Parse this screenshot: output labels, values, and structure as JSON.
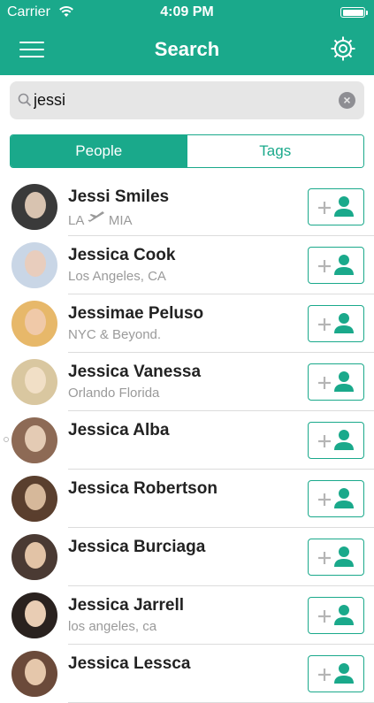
{
  "status_bar": {
    "carrier": "Carrier",
    "time": "4:09 PM"
  },
  "nav": {
    "title": "Search"
  },
  "search": {
    "value": "jessi",
    "clear_icon": "clear-icon"
  },
  "segments": [
    {
      "label": "People",
      "active": true
    },
    {
      "label": "Tags",
      "active": false
    }
  ],
  "colors": {
    "accent": "#1aa98b",
    "separator": "#dcdcdc",
    "subtitle": "#9a9a9a"
  },
  "people": [
    {
      "name": "Jessi Smiles",
      "subtitle_pre": "LA ",
      "subtitle_icon": "airplane-icon",
      "subtitle_post": " MIA"
    },
    {
      "name": "Jessica Cook",
      "subtitle": "Los Angeles, CA"
    },
    {
      "name": "Jessimae Peluso",
      "subtitle": "NYC & Beyond."
    },
    {
      "name": "Jessica Vanessa",
      "subtitle": "Orlando Florida"
    },
    {
      "name": "Jessica Alba",
      "subtitle": ""
    },
    {
      "name": "Jessica Robertson",
      "subtitle": ""
    },
    {
      "name": "Jessica Burciaga",
      "subtitle": ""
    },
    {
      "name": "Jessica Jarrell",
      "subtitle": "los angeles, ca"
    },
    {
      "name": "Jessica Lessca",
      "subtitle": ""
    }
  ],
  "follow_button_icon": "add-person-icon"
}
